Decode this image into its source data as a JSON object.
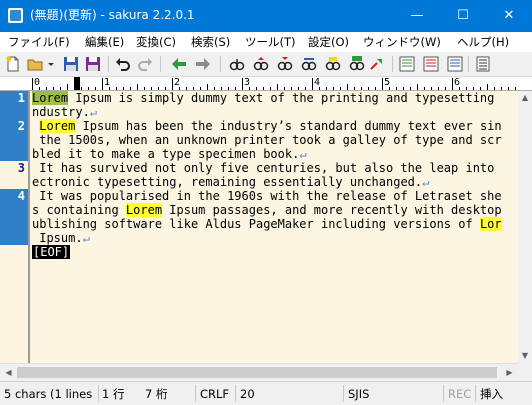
{
  "window": {
    "title": "(無題)(更新) - sakura 2.2.0.1",
    "min_glyph": "—",
    "max_glyph": "☐",
    "close_glyph": "✕"
  },
  "menu": [
    {
      "label": "ファイル(F)"
    },
    {
      "label": "編集(E)"
    },
    {
      "label": "変換(C)"
    },
    {
      "label": "検索(S)"
    },
    {
      "label": "ツール(T)"
    },
    {
      "label": "設定(O)"
    },
    {
      "label": "ウィンドウ(W)"
    },
    {
      "label": "ヘルプ(H)"
    }
  ],
  "toolbar": [
    "new-file-icon",
    "open-file-icon",
    "open-dropdown-icon",
    "save-icon",
    "save-as-icon",
    "undo-icon",
    "redo-icon",
    "jump-back-icon",
    "jump-forward-icon",
    "search-icon",
    "search-prev-icon",
    "search-next-icon",
    "replace-icon",
    "search-mark-icon",
    "grep-icon",
    "outline-icon",
    "tag-jump-icon",
    "keyword-help-icon",
    "settings-icon"
  ],
  "ruler": {
    "labels": [
      "0",
      "1",
      "2",
      "3",
      "4",
      "5",
      "6"
    ]
  },
  "editor": {
    "line_numbers": [
      "1",
      "2",
      "3",
      "4"
    ],
    "lines": [
      {
        "line": "1",
        "segments": [
          {
            "t": "Lorem",
            "c": "cursor-hl"
          },
          {
            "t": " Ipsum is simply dummy text of the printing and typesetting i"
          }
        ]
      },
      {
        "line": "",
        "segments": [
          {
            "t": "ndustry."
          },
          {
            "t": "↵",
            "c": "eol"
          }
        ]
      },
      {
        "line": "2",
        "segments": [
          {
            "t": " "
          },
          {
            "t": "Lorem",
            "c": "hl"
          },
          {
            "t": " Ipsum has been the industry’s standard dummy text ever since"
          }
        ]
      },
      {
        "line": "",
        "segments": [
          {
            "t": " the 1500s, when an unknown printer took a galley of type and scram"
          }
        ]
      },
      {
        "line": "",
        "segments": [
          {
            "t": "bled it to make a type specimen book."
          },
          {
            "t": "↵",
            "c": "eol"
          }
        ]
      },
      {
        "line": "3",
        "segments": [
          {
            "t": " It has survived not only five centuries, but also the leap into el"
          }
        ]
      },
      {
        "line": "",
        "segments": [
          {
            "t": "ectronic typesetting, remaining essentially unchanged."
          },
          {
            "t": "↵",
            "c": "eol"
          }
        ]
      },
      {
        "line": "4",
        "segments": [
          {
            "t": " It was popularised in the 1960s with the release of Letraset sheet"
          }
        ]
      },
      {
        "line": "",
        "segments": [
          {
            "t": "s containing "
          },
          {
            "t": "Lorem",
            "c": "hl"
          },
          {
            "t": " Ipsum passages, and more recently with desktop p"
          }
        ]
      },
      {
        "line": "",
        "segments": [
          {
            "t": "ublishing software like Aldus PageMaker including versions of "
          },
          {
            "t": "Lorem",
            "c": "hl"
          }
        ]
      },
      {
        "line": "",
        "segments": [
          {
            "t": " Ipsum."
          },
          {
            "t": "↵",
            "c": "eol"
          }
        ]
      }
    ],
    "eof_label": "[EOF]"
  },
  "status": {
    "selection": "5 chars (1 lines",
    "row": "1 行",
    "col": "7 桁",
    "newline": "CRLF",
    "code": "20",
    "encoding": "SJIS",
    "rec": "REC",
    "insert_mode": "挿入"
  },
  "colors": {
    "title_bar": "#0078d7",
    "editor_bg": "#fbf5e2",
    "search_highlight": "#ffff33",
    "line_number_bg": "#2f80c8"
  }
}
